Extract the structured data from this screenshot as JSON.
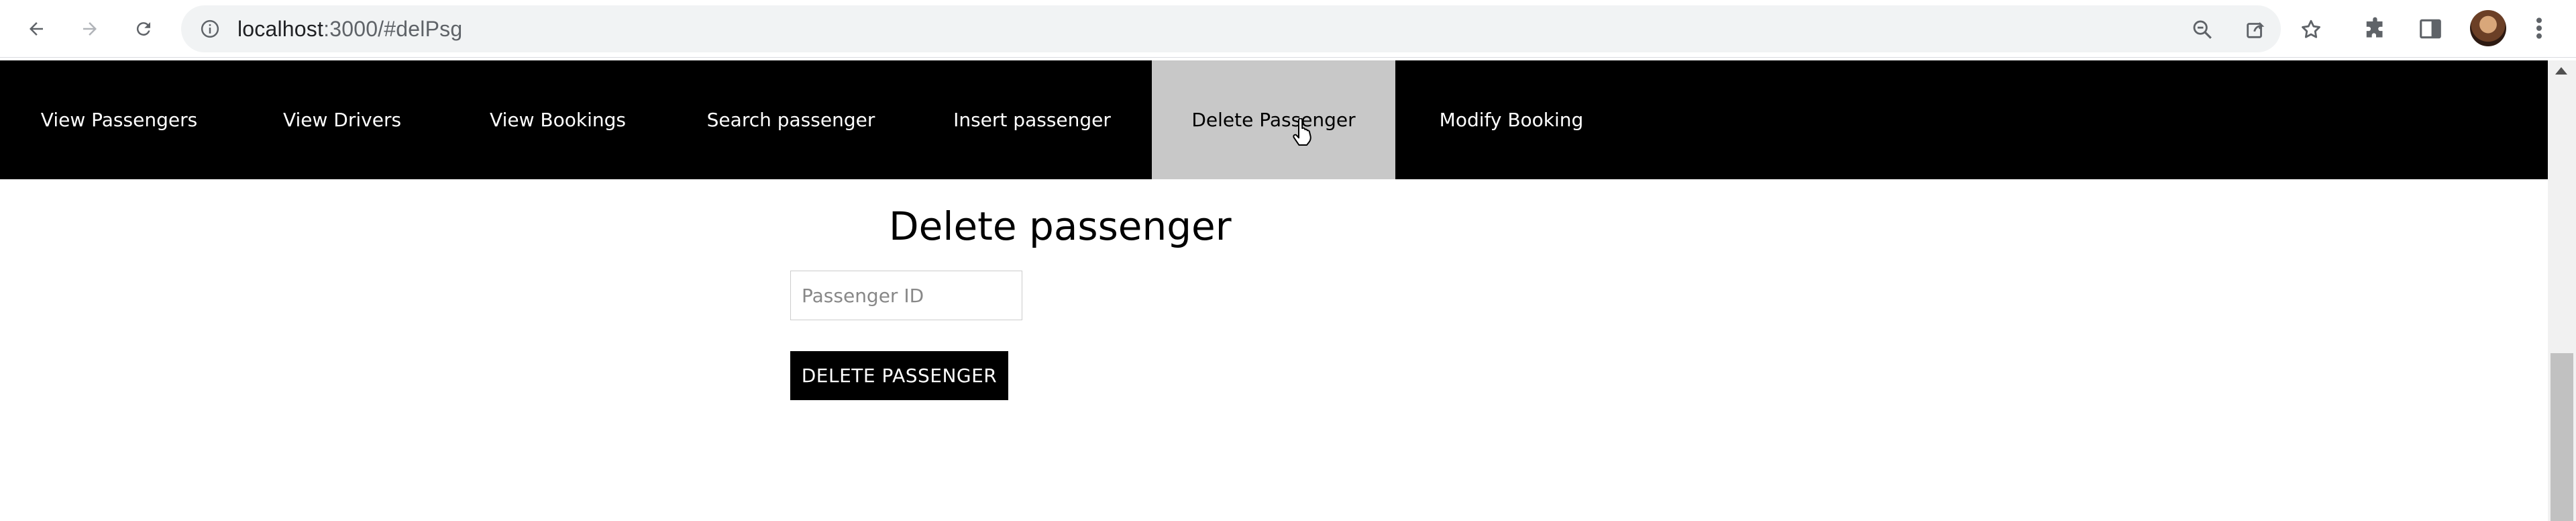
{
  "browser": {
    "url_host": "localhost",
    "url_path": ":3000/#delPsg",
    "icons": {
      "back": "arrow-left-icon",
      "forward": "arrow-right-icon",
      "reload": "reload-icon",
      "site_info": "info-icon",
      "zoom": "zoom-out-icon",
      "share": "share-icon",
      "bookmark": "star-icon",
      "extensions": "puzzle-icon",
      "side_panel": "side-panel-icon",
      "profile": "avatar",
      "menu": "kebab-menu-icon"
    }
  },
  "nav": {
    "items": [
      {
        "label": "View Passengers"
      },
      {
        "label": "View Drivers"
      },
      {
        "label": "View Bookings"
      },
      {
        "label": "Search passenger"
      },
      {
        "label": "Insert passenger"
      },
      {
        "label": "Delete Passenger",
        "active": true
      },
      {
        "label": "Modify Booking"
      }
    ],
    "active_bg": "#c8c8c8",
    "bg": "#000000"
  },
  "main": {
    "title": "Delete passenger",
    "input_placeholder": "Passenger ID",
    "input_value": "",
    "button_label": "DELETE PASSENGER"
  }
}
